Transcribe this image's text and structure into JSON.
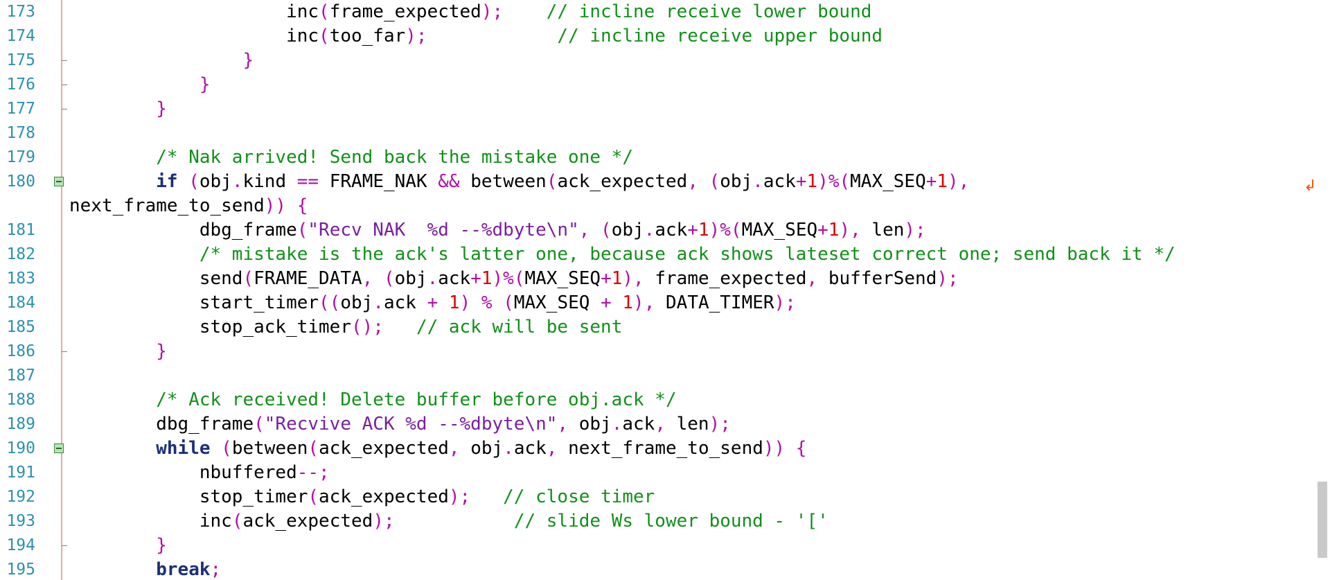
{
  "editor": {
    "lines": [
      {
        "num": "173",
        "code": [
          [
            "",
            "                    inc"
          ],
          [
            "p",
            "("
          ],
          [
            "",
            "frame_expected"
          ],
          [
            "p",
            ");"
          ],
          [
            "",
            "    "
          ],
          [
            "c",
            "// incline receive lower bound"
          ]
        ]
      },
      {
        "num": "174",
        "code": [
          [
            "",
            "                    inc"
          ],
          [
            "p",
            "("
          ],
          [
            "",
            "too_far"
          ],
          [
            "p",
            ");"
          ],
          [
            "",
            "            "
          ],
          [
            "c",
            "// incline receive upper bound"
          ]
        ]
      },
      {
        "num": "175",
        "code": [
          [
            "",
            "                "
          ],
          [
            "p",
            "}"
          ]
        ]
      },
      {
        "num": "176",
        "code": [
          [
            "",
            "            "
          ],
          [
            "p",
            "}"
          ]
        ]
      },
      {
        "num": "177",
        "code": [
          [
            "",
            "        "
          ],
          [
            "p",
            "}"
          ]
        ]
      },
      {
        "num": "178",
        "code": []
      },
      {
        "num": "179",
        "code": [
          [
            "",
            "        "
          ],
          [
            "c",
            "/* Nak arrived! Send back the mistake one */"
          ]
        ]
      },
      {
        "num": "180",
        "code": [
          [
            "",
            "        "
          ],
          [
            "k",
            "if"
          ],
          [
            "",
            " "
          ],
          [
            "p",
            "("
          ],
          [
            "",
            "obj"
          ],
          [
            "p",
            "."
          ],
          [
            "",
            "kind "
          ],
          [
            "p",
            "=="
          ],
          [
            "",
            " FRAME_NAK "
          ],
          [
            "p",
            "&&"
          ],
          [
            "",
            " between"
          ],
          [
            "p",
            "("
          ],
          [
            "",
            "ack_expected"
          ],
          [
            "p",
            ","
          ],
          [
            "",
            " "
          ],
          [
            "p",
            "("
          ],
          [
            "",
            "obj"
          ],
          [
            "p",
            "."
          ],
          [
            "",
            "ack"
          ],
          [
            "p",
            "+"
          ],
          [
            "n",
            "1"
          ],
          [
            "p",
            ")%("
          ],
          [
            "",
            "MAX_SEQ"
          ],
          [
            "p",
            "+"
          ],
          [
            "n",
            "1"
          ],
          [
            "p",
            "),"
          ]
        ]
      },
      {
        "num": "",
        "code": [
          [
            "",
            "next_frame_to_send"
          ],
          [
            "p",
            "))"
          ],
          [
            "",
            " "
          ],
          [
            "p",
            "{"
          ]
        ]
      },
      {
        "num": "181",
        "code": [
          [
            "",
            "            dbg_frame"
          ],
          [
            "p",
            "("
          ],
          [
            "s",
            "\"Recv NAK  %d --%dbyte\\n\""
          ],
          [
            "p",
            ","
          ],
          [
            "",
            " "
          ],
          [
            "p",
            "("
          ],
          [
            "",
            "obj"
          ],
          [
            "p",
            "."
          ],
          [
            "",
            "ack"
          ],
          [
            "p",
            "+"
          ],
          [
            "n",
            "1"
          ],
          [
            "p",
            ")%("
          ],
          [
            "",
            "MAX_SEQ"
          ],
          [
            "p",
            "+"
          ],
          [
            "n",
            "1"
          ],
          [
            "p",
            "),"
          ],
          [
            "",
            " len"
          ],
          [
            "p",
            ");"
          ]
        ]
      },
      {
        "num": "182",
        "code": [
          [
            "",
            "            "
          ],
          [
            "c",
            "/* mistake is the ack's latter one, because ack shows lateset correct one; send back it */"
          ]
        ]
      },
      {
        "num": "183",
        "code": [
          [
            "",
            "            send"
          ],
          [
            "p",
            "("
          ],
          [
            "",
            "FRAME_DATA"
          ],
          [
            "p",
            ","
          ],
          [
            "",
            " "
          ],
          [
            "p",
            "("
          ],
          [
            "",
            "obj"
          ],
          [
            "p",
            "."
          ],
          [
            "",
            "ack"
          ],
          [
            "p",
            "+"
          ],
          [
            "n",
            "1"
          ],
          [
            "p",
            ")%("
          ],
          [
            "",
            "MAX_SEQ"
          ],
          [
            "p",
            "+"
          ],
          [
            "n",
            "1"
          ],
          [
            "p",
            "),"
          ],
          [
            "",
            " frame_expected"
          ],
          [
            "p",
            ","
          ],
          [
            "",
            " bufferSend"
          ],
          [
            "p",
            ");"
          ]
        ]
      },
      {
        "num": "184",
        "code": [
          [
            "",
            "            start_timer"
          ],
          [
            "p",
            "(("
          ],
          [
            "",
            "obj"
          ],
          [
            "p",
            "."
          ],
          [
            "",
            "ack "
          ],
          [
            "p",
            "+"
          ],
          [
            "",
            " "
          ],
          [
            "n",
            "1"
          ],
          [
            "p",
            ")"
          ],
          [
            "",
            " "
          ],
          [
            "p",
            "%"
          ],
          [
            "",
            " "
          ],
          [
            "p",
            "("
          ],
          [
            "",
            "MAX_SEQ "
          ],
          [
            "p",
            "+"
          ],
          [
            "",
            " "
          ],
          [
            "n",
            "1"
          ],
          [
            "p",
            "),"
          ],
          [
            "",
            " DATA_TIMER"
          ],
          [
            "p",
            ");"
          ]
        ]
      },
      {
        "num": "185",
        "code": [
          [
            "",
            "            stop_ack_timer"
          ],
          [
            "p",
            "();"
          ],
          [
            "",
            "   "
          ],
          [
            "c",
            "// ack will be sent"
          ]
        ]
      },
      {
        "num": "186",
        "code": [
          [
            "",
            "        "
          ],
          [
            "p",
            "}"
          ]
        ]
      },
      {
        "num": "187",
        "code": []
      },
      {
        "num": "188",
        "code": [
          [
            "",
            "        "
          ],
          [
            "c",
            "/* Ack received! Delete buffer before obj.ack */"
          ]
        ]
      },
      {
        "num": "189",
        "code": [
          [
            "",
            "        dbg_frame"
          ],
          [
            "p",
            "("
          ],
          [
            "s",
            "\"Recvive ACK %d --%dbyte\\n\""
          ],
          [
            "p",
            ","
          ],
          [
            "",
            " obj"
          ],
          [
            "p",
            "."
          ],
          [
            "",
            "ack"
          ],
          [
            "p",
            ","
          ],
          [
            "",
            " len"
          ],
          [
            "p",
            ");"
          ]
        ]
      },
      {
        "num": "190",
        "code": [
          [
            "",
            "        "
          ],
          [
            "k",
            "while"
          ],
          [
            "",
            " "
          ],
          [
            "p",
            "("
          ],
          [
            "",
            "between"
          ],
          [
            "p",
            "("
          ],
          [
            "",
            "ack_expected"
          ],
          [
            "p",
            ","
          ],
          [
            "",
            " obj"
          ],
          [
            "p",
            "."
          ],
          [
            "",
            "ack"
          ],
          [
            "p",
            ","
          ],
          [
            "",
            " next_frame_to_send"
          ],
          [
            "p",
            "))"
          ],
          [
            "",
            " "
          ],
          [
            "p",
            "{"
          ]
        ]
      },
      {
        "num": "191",
        "code": [
          [
            "",
            "            nbuffered"
          ],
          [
            "p",
            "--;"
          ]
        ]
      },
      {
        "num": "192",
        "code": [
          [
            "",
            "            stop_timer"
          ],
          [
            "p",
            "("
          ],
          [
            "",
            "ack_expected"
          ],
          [
            "p",
            ");"
          ],
          [
            "",
            "   "
          ],
          [
            "c",
            "// close timer"
          ]
        ]
      },
      {
        "num": "193",
        "code": [
          [
            "",
            "            inc"
          ],
          [
            "p",
            "("
          ],
          [
            "",
            "ack_expected"
          ],
          [
            "p",
            ");"
          ],
          [
            "",
            "           "
          ],
          [
            "c",
            "// slide Ws lower bound - '['"
          ]
        ]
      },
      {
        "num": "194",
        "code": [
          [
            "",
            "        "
          ],
          [
            "p",
            "}"
          ]
        ]
      },
      {
        "num": "195",
        "code": [
          [
            "",
            "        "
          ],
          [
            "k",
            "break"
          ],
          [
            "p",
            ";"
          ]
        ]
      }
    ],
    "folds": [
      "180",
      "190"
    ],
    "ticks": [
      "175",
      "176",
      "177",
      "186",
      "194"
    ],
    "wrap_marker_line": "180",
    "wrap_marker_icon": "wrap-arrow-icon"
  },
  "colors": {
    "keyword": "#1a2f7a",
    "punctuation": "#b00fa5",
    "number": "#e00000",
    "string": "#7a1ea0",
    "comment": "#109018",
    "line_number": "#2b91af"
  }
}
